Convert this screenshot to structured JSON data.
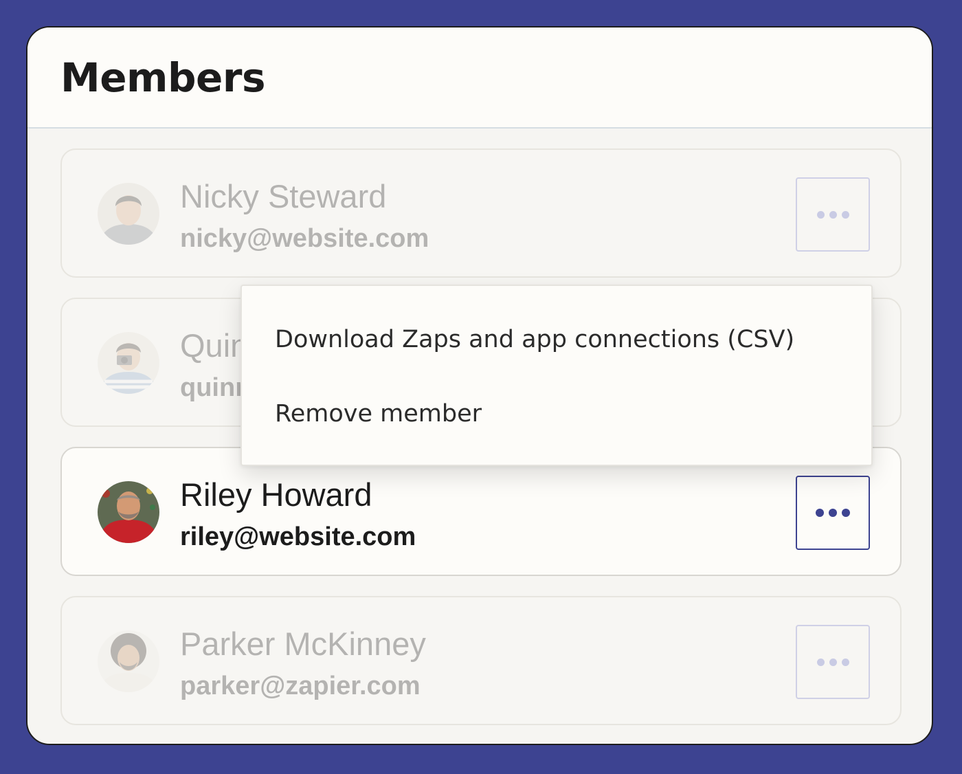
{
  "title": "Members",
  "members": [
    {
      "name": "Nicky Steward",
      "email": "nicky@website.com",
      "avatar": "photo-avatar",
      "dimmed": true
    },
    {
      "name": "Quinn",
      "email": "quinn",
      "avatar": "photo-avatar",
      "dimmed": true
    },
    {
      "name": "Riley Howard",
      "email": "riley@website.com",
      "avatar": "photo-avatar",
      "dimmed": false
    },
    {
      "name": "Parker McKinney",
      "email": "parker@zapier.com",
      "avatar": "photo-avatar",
      "dimmed": true
    }
  ],
  "menu": {
    "items": [
      "Download Zaps and app connections (CSV)",
      "Remove member"
    ]
  },
  "colors": {
    "background": "#3d4391",
    "accent": "#3d4391",
    "panel": "#f6f5f2",
    "text": "#1c1c1c"
  },
  "icons": {
    "more": "more-horizontal-icon"
  }
}
